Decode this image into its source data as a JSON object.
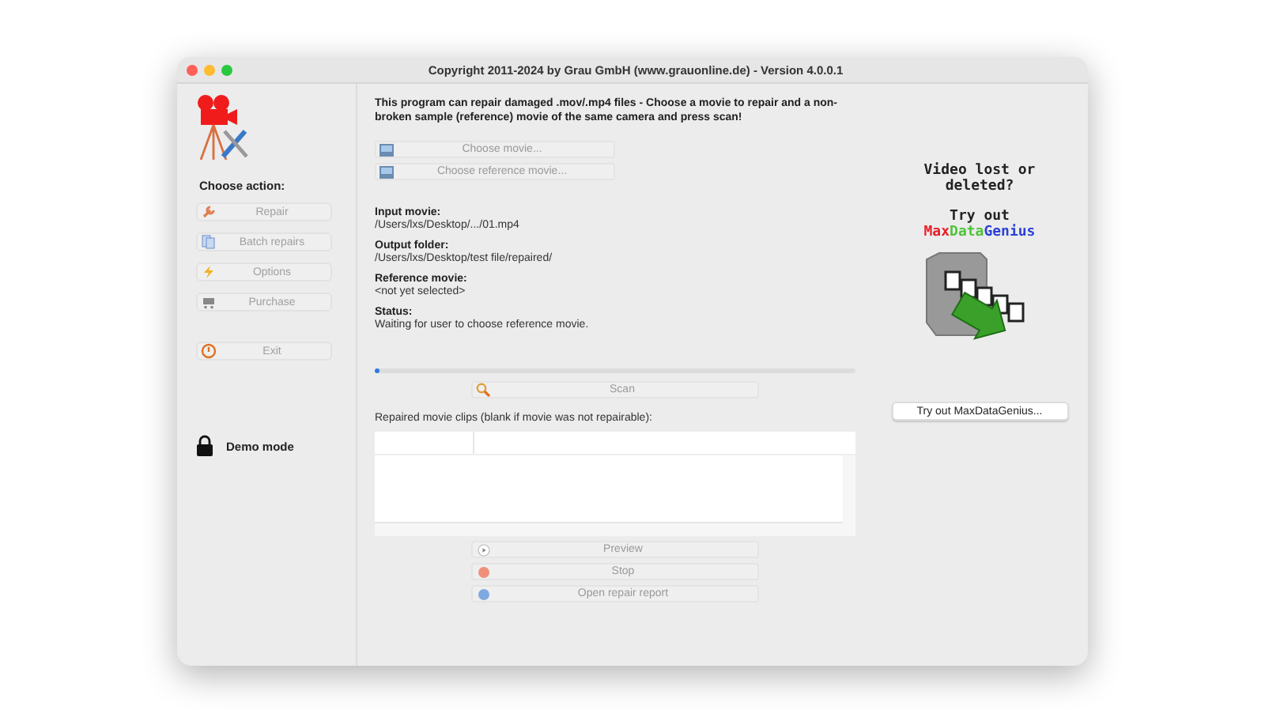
{
  "window": {
    "title": "Copyright 2011-2024 by Grau GmbH (www.grauonline.de) - Version 4.0.0.1"
  },
  "sidebar": {
    "heading": "Choose action:",
    "actions": [
      {
        "label": "Repair",
        "kind": "wrench",
        "disabled": true
      },
      {
        "label": "Batch repairs",
        "kind": "docs",
        "disabled": true
      },
      {
        "label": "Options",
        "kind": "bolt",
        "disabled": true
      },
      {
        "label": "Purchase",
        "kind": "cart",
        "disabled": true
      },
      {
        "label": "Exit",
        "kind": "power",
        "disabled": true
      }
    ],
    "mode": "Demo mode"
  },
  "main": {
    "intro": "This program can repair damaged .mov/.mp4 files - Choose a movie to repair and a non-broken sample (reference) movie of the same camera and press scan!",
    "choose_buttons": [
      {
        "label": "Choose movie...",
        "disabled": true
      },
      {
        "label": "Choose reference movie...",
        "disabled": true
      }
    ],
    "fields": [
      {
        "label": "Input movie:",
        "value": "/Users/lxs/Desktop/.../01.mp4"
      },
      {
        "label": "Output folder:",
        "value": "/Users/lxs/Desktop/test file/repaired/"
      },
      {
        "label": "Reference movie:",
        "value": "<not yet selected>"
      },
      {
        "label": "Status:",
        "value": "Waiting for user to choose reference movie."
      }
    ],
    "progress": {
      "level": 0.01
    },
    "scan_button": {
      "label": "Scan",
      "disabled": true
    },
    "clips_label": "Repaired movie clips (blank if movie was not repairable):",
    "bottom_buttons": [
      {
        "label": "Preview",
        "kind": "play",
        "disabled": true
      },
      {
        "label": "Stop",
        "kind": "stop",
        "disabled": true
      },
      {
        "label": "Open repair report",
        "kind": "info",
        "disabled": true
      }
    ]
  },
  "promo": {
    "line1": "Video lost or deleted?",
    "line2": "Try out",
    "brand": [
      {
        "text": "Max",
        "color": "#e8202a"
      },
      {
        "text": "Data",
        "color": "#4fc43a"
      },
      {
        "text": "Genius",
        "color": "#2a3fd8"
      }
    ],
    "button": {
      "label": "Try out MaxDataGenius...",
      "disabled": false
    }
  }
}
